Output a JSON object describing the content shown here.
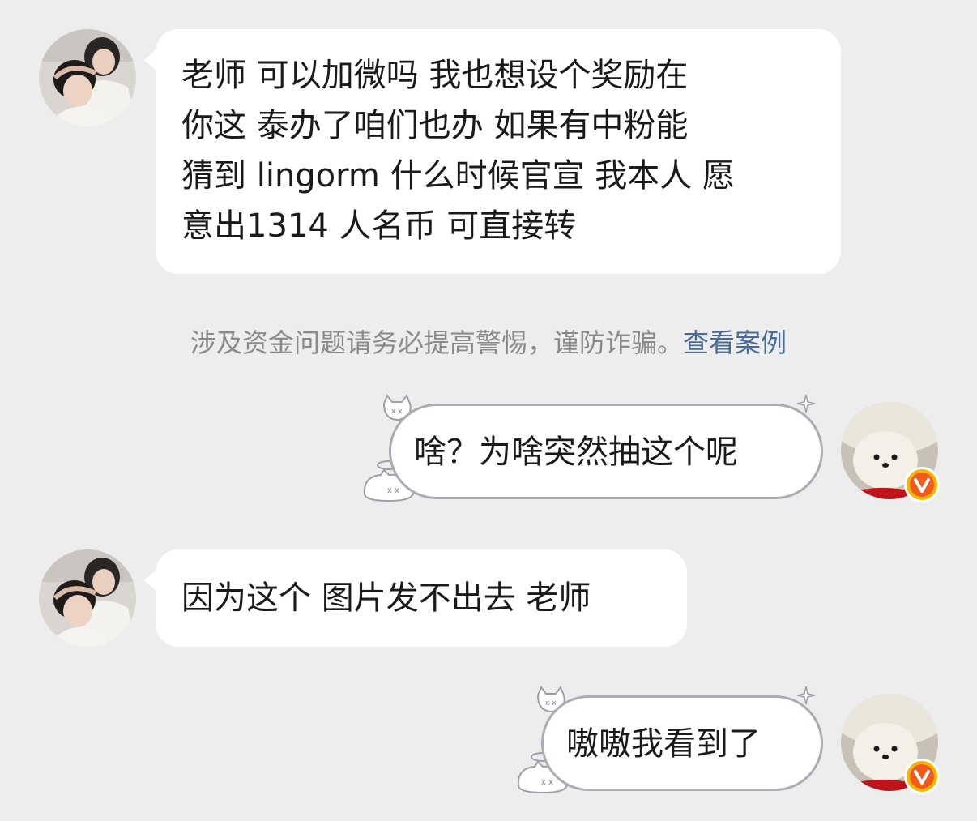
{
  "messages": [
    {
      "sender": "other",
      "text": "老师 可以加微吗 我也想设个奖励在你这 泰办了咱们也办 如果有中粉能猜到 lingorm 什么时候官宣 我本人 愿意出1314 人名币 可直接转",
      "lines": [
        "老师 可以加微吗 我也想设个奖励在",
        "你这 泰办了咱们也办 如果有中粉能",
        "猜到 lingorm 什么时候官宣 我本人 愿",
        "意出1314 人名币 可直接转"
      ]
    },
    {
      "sender": "self",
      "text": "啥？为啥突然抽这个呢"
    },
    {
      "sender": "other",
      "text": "因为这个 图片发不出去 老师"
    },
    {
      "sender": "self",
      "text": "嗷嗷我看到了"
    }
  ],
  "notice": {
    "text": "涉及资金问题请务必提高警惕，谨防诈骗。",
    "link": "查看案例"
  },
  "colors": {
    "background": "#ededed",
    "bubble": "#ffffff",
    "link": "#4a6a9a",
    "badge": "#f7b500"
  }
}
